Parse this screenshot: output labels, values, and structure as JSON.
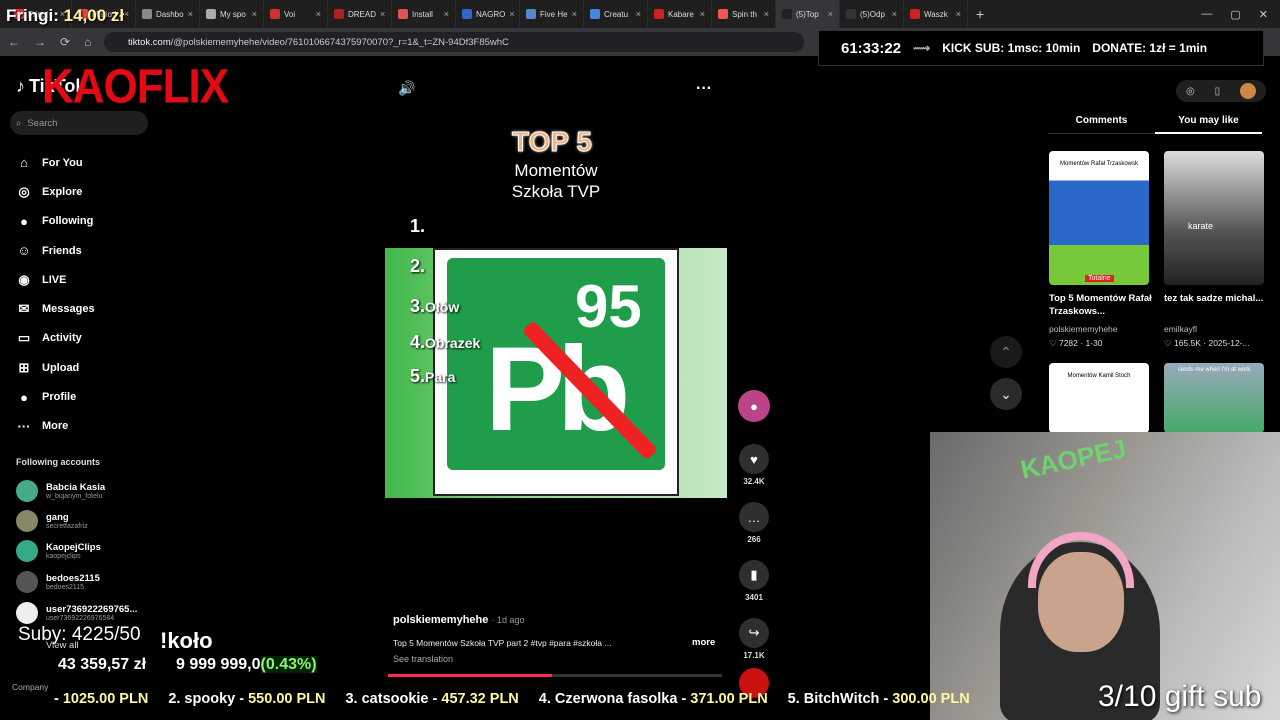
{
  "browser": {
    "tabs": [
      {
        "label": "Fringi",
        "active": false
      },
      {
        "label": "Mario I",
        "active": false
      },
      {
        "label": "Dashbo",
        "active": false
      },
      {
        "label": "My spo",
        "active": false
      },
      {
        "label": "Voi",
        "active": false
      },
      {
        "label": "DREAD",
        "active": false
      },
      {
        "label": "Install",
        "active": false
      },
      {
        "label": "NAGRO",
        "active": false
      },
      {
        "label": "Five He",
        "active": false
      },
      {
        "label": "Creatu",
        "active": false
      },
      {
        "label": "Kabare",
        "active": false
      },
      {
        "label": "Spin th",
        "active": false
      },
      {
        "label": "(5)Top",
        "active": true
      },
      {
        "label": "(5)Odp",
        "active": false
      },
      {
        "label": "Waszk",
        "active": false
      }
    ],
    "url_domain": "tiktok.com",
    "url_path": "/@polskiememyhehe/video/7610106674375970070?_r=1&_t=ZN-94Df3F85whC"
  },
  "stream": {
    "fringi_label": "Fringi:",
    "fringi_amount": "14,00 zł",
    "timer": "61:33:22",
    "kick_text": "KICK SUB: 1msc: 10min",
    "donate_text": "DONATE: 1zł = 1min",
    "suby": "Suby: 4225/50",
    "kolo": "!koło",
    "pln_total": "43 359,57 zł",
    "pln_goal": "9 999 999,0",
    "pln_percent": "(0.43%)",
    "gift_text": "3/10 gift sub",
    "ticker": [
      {
        "name": "",
        "amount": "1025.00 PLN"
      },
      {
        "name": "2. spooky",
        "amount": "550.00 PLN"
      },
      {
        "name": "3. catsookie",
        "amount": "457.32 PLN"
      },
      {
        "name": "4. Czerwona fasolka",
        "amount": "371.00 PLN"
      },
      {
        "name": "5. BitchWitch",
        "amount": "300.00 PLN"
      }
    ],
    "kaoflix": "KAOFLIX"
  },
  "sidebar": {
    "logo": "TikTok",
    "search_placeholder": "Search",
    "nav": [
      {
        "label": "For You",
        "icon": "home-icon"
      },
      {
        "label": "Explore",
        "icon": "compass-icon"
      },
      {
        "label": "Following",
        "icon": "following-icon"
      },
      {
        "label": "Friends",
        "icon": "friends-icon"
      },
      {
        "label": "LIVE",
        "icon": "live-icon"
      },
      {
        "label": "Messages",
        "icon": "messages-icon"
      },
      {
        "label": "Activity",
        "icon": "activity-icon"
      },
      {
        "label": "Upload",
        "icon": "upload-icon"
      },
      {
        "label": "Profile",
        "icon": "profile-icon"
      },
      {
        "label": "More",
        "icon": "more-icon"
      }
    ],
    "following_header": "Following accounts",
    "accounts": [
      {
        "name": "Babcia Kasia",
        "handle": "w_bujanym_fotelu"
      },
      {
        "name": "gang",
        "handle": "secretfazafriz"
      },
      {
        "name": "KaopejClips",
        "handle": "kaopejclips"
      },
      {
        "name": "bedoes2115",
        "handle": "bedoes2115"
      },
      {
        "name": "user736922269765...",
        "handle": "user7369222697658​4"
      }
    ],
    "view_all": "View all",
    "company": "Company"
  },
  "video": {
    "title_top": "TOP 5",
    "title_sub1": "Momentów",
    "title_sub2": "Szkoła TVP",
    "list": [
      {
        "num": "1.",
        "text": ""
      },
      {
        "num": "2.",
        "text": ""
      },
      {
        "num": "3.",
        "text": "Ołów"
      },
      {
        "num": "4.",
        "text": "Obrazek"
      },
      {
        "num": "5.",
        "text": "Para"
      }
    ],
    "sign_number": "95",
    "sign_letters": "Pb",
    "author": "polskiememyhehe",
    "posted": "· 1d ago",
    "caption": "Top 5 Momentów Szkoła TVP part 2 #tvp #para #szkoła ...",
    "more": "more",
    "see_translation": "See translation",
    "progress": 0.49,
    "actions": {
      "likes": "32.4K",
      "comments": "266",
      "saves": "3401",
      "shares": "17.1K"
    }
  },
  "rightpanel": {
    "tabs": [
      "Comments",
      "You may like"
    ],
    "cards": [
      {
        "title": "Top 5 Momentów Rafał Trzaskows...",
        "user": "polskiememyhehe",
        "meta": "♡ 7282 · 1-30",
        "thumb_text": "Momentów Rafał Trzaskowsk",
        "badge": "Totalne"
      },
      {
        "title": "tez tak sadze michal...",
        "user": "emilkayfl",
        "meta": "♡ 165.5K · 2025-12-...",
        "thumb_text": "karate",
        "badge": ""
      }
    ],
    "thumb3_text": "Momentów Kamil Stoch",
    "thumb4_text": "sends me when I'm at work"
  }
}
